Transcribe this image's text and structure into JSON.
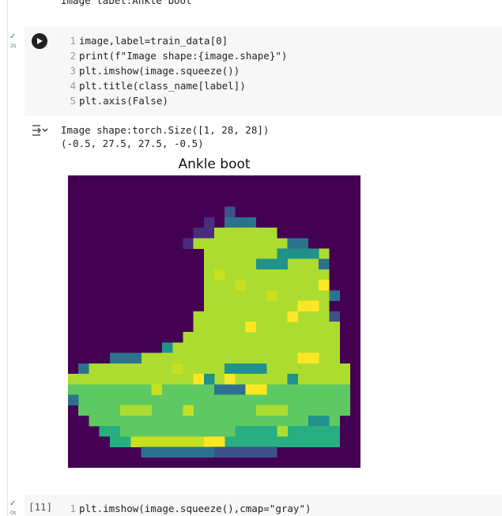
{
  "previous_output": {
    "text": "Image label:Ankle boot"
  },
  "cell1": {
    "status_time": "2s",
    "code_lines": [
      {
        "n": "1",
        "text": "image,label=train_data[0]"
      },
      {
        "n": "2",
        "text": "print(f\"Image shape:{image.shape}\")"
      },
      {
        "n": "3",
        "text": "plt.imshow(image.squeeze())"
      },
      {
        "n": "4",
        "text": "plt.title(class_name[label])"
      },
      {
        "n": "5",
        "text": "plt.axis(False)"
      }
    ],
    "output_lines": [
      "Image shape:torch.Size([1, 28, 28])",
      "(-0.5, 27.5, 27.5, -0.5)"
    ],
    "figure_title": "Ankle boot",
    "colormap_background": "#440154"
  },
  "cell2": {
    "exec_count": "[11]",
    "status_time": "0s",
    "code_lines": [
      {
        "n": "1",
        "text": "plt.imshow(image.squeeze(),cmap=\"gray\")"
      }
    ]
  },
  "icons": {
    "run": "play-circle-icon",
    "output_toggle": "output-collapse-icon",
    "status": "check-icon"
  },
  "colors": {
    "check_green": "#1e8e3e",
    "viridis_low": "#440154",
    "viridis_high": "#fde725"
  }
}
